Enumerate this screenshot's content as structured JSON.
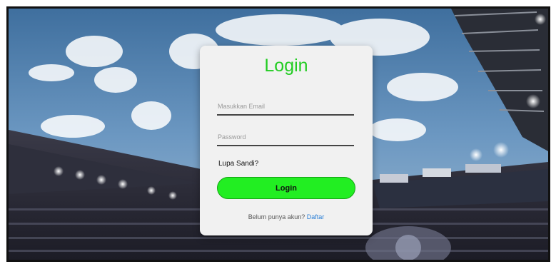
{
  "login": {
    "title": "Login",
    "email_placeholder": "Masukkan Email",
    "password_placeholder": "Password",
    "forgot_label": "Lupa Sandi?",
    "submit_label": "Login",
    "signup_prompt": "Belum punya akun?",
    "signup_link": "Daftar"
  },
  "colors": {
    "accent": "#22ee22",
    "title": "#22cc22",
    "link": "#2b7fd6",
    "card": "#f1f1f1"
  }
}
